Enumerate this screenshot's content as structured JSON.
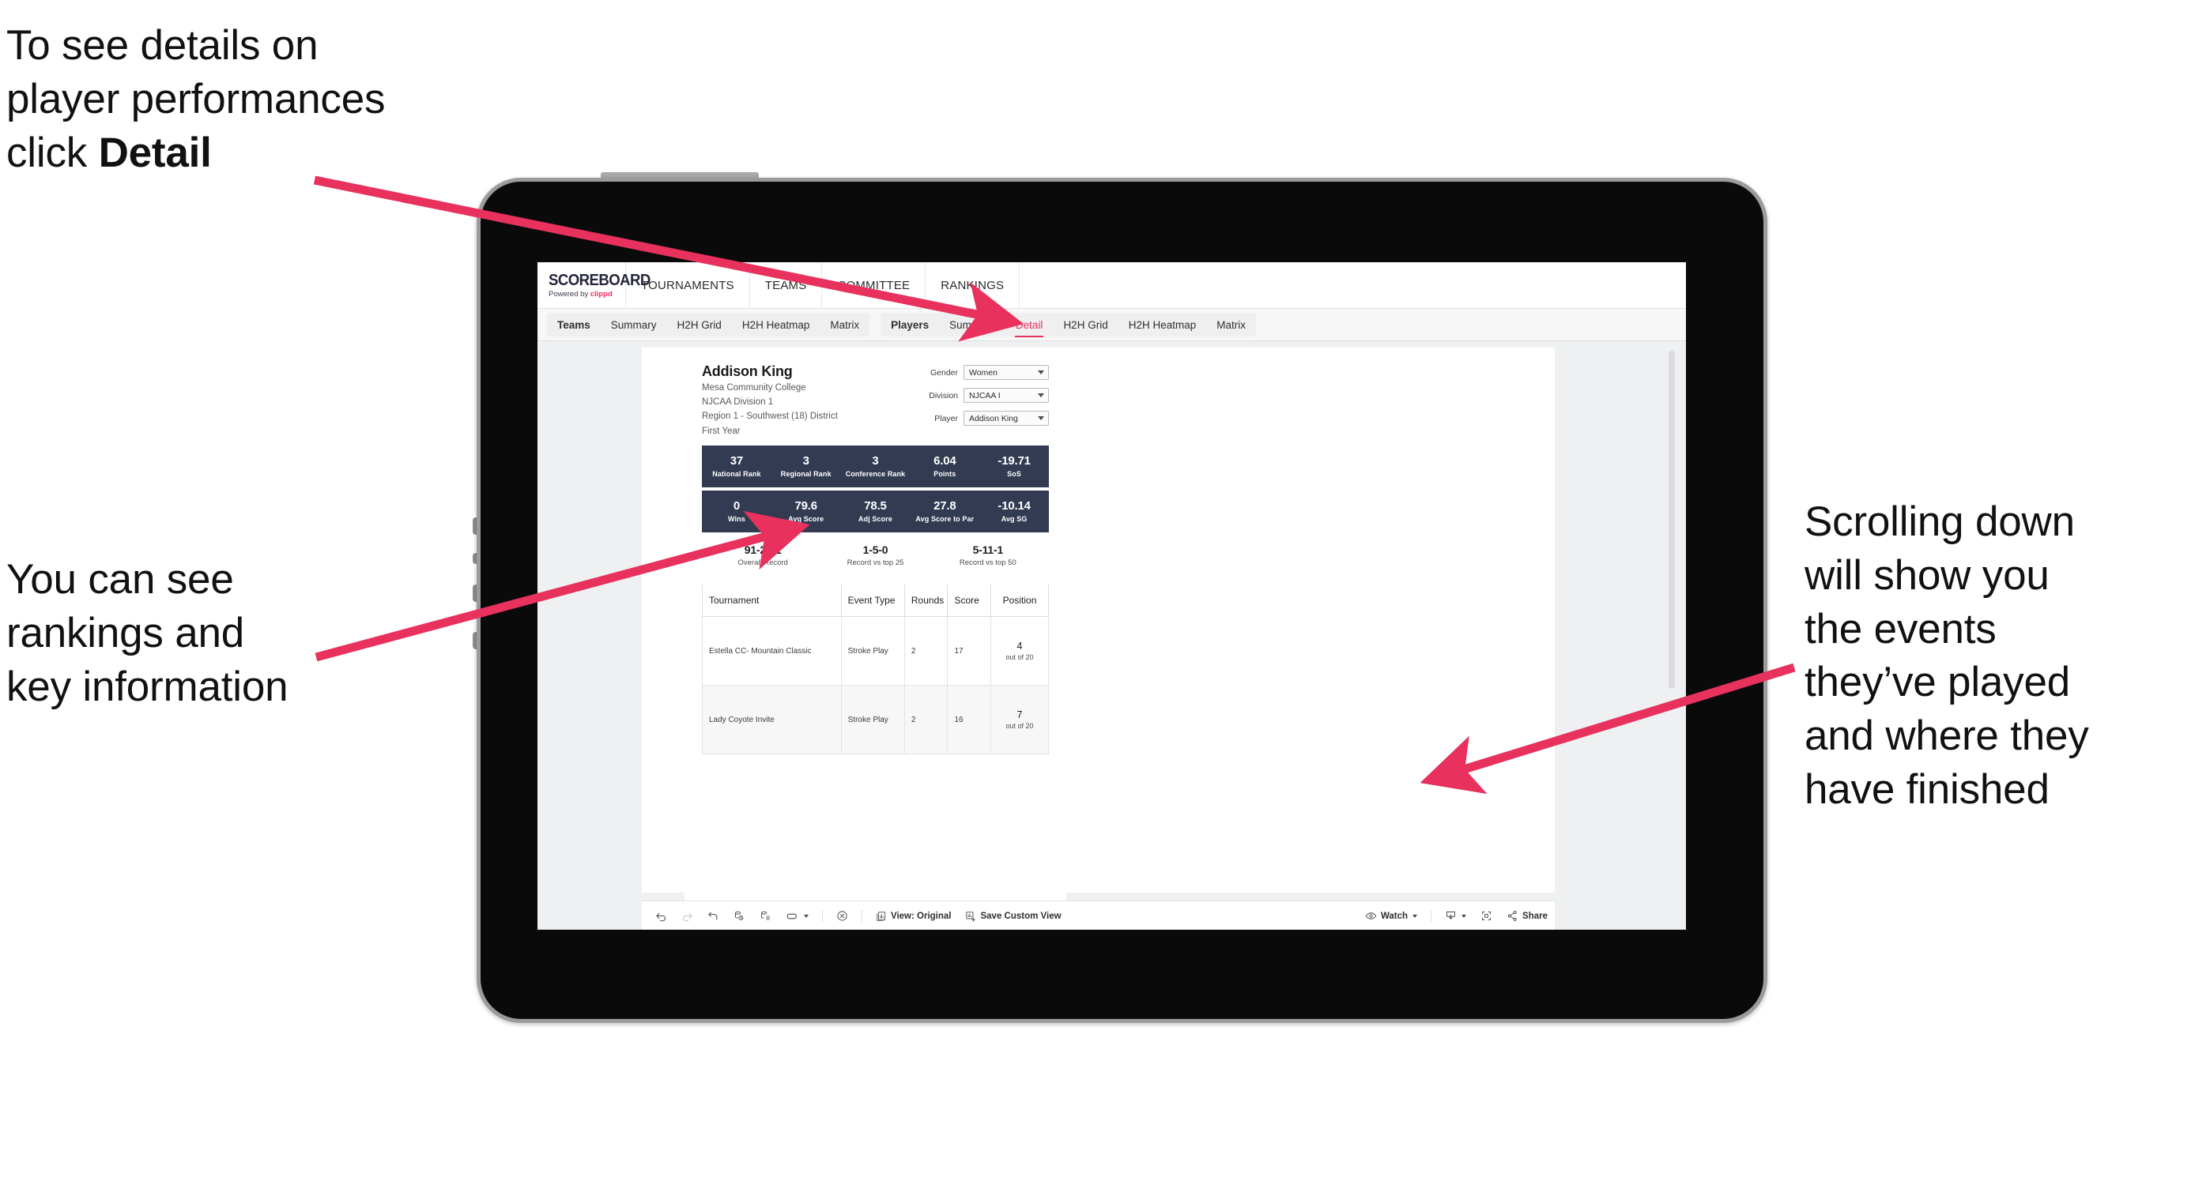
{
  "annotations": {
    "top_left": "To see details on\nplayer performances\nclick ",
    "top_left_bold": "Detail",
    "left": "You can see\nrankings and\nkey information",
    "right": "Scrolling down\nwill show you\nthe events\nthey’ve played\nand where they\nhave finished"
  },
  "colors": {
    "accent_pink": "#ec2d62",
    "arrow_pink": "#e8315d",
    "stat_bar_navy": "#323b52",
    "active_tab": "#e8315d"
  },
  "app": {
    "logo": {
      "main": "SCOREBOARD",
      "powered_prefix": "Powered by ",
      "brand": "clippd"
    },
    "top_nav": [
      "TOURNAMENTS",
      "TEAMS",
      "COMMITTEE",
      "RANKINGS"
    ],
    "sub_nav": {
      "teams_group": [
        "Teams",
        "Summary",
        "H2H Grid",
        "H2H Heatmap",
        "Matrix"
      ],
      "players_group": [
        "Players",
        "Summary",
        "Detail",
        "H2H Grid",
        "H2H Heatmap",
        "Matrix"
      ],
      "active": "Detail"
    }
  },
  "player": {
    "name": "Addison King",
    "school": "Mesa Community College",
    "division": "NJCAA Division 1",
    "region": "Region 1 - Southwest (18) District",
    "year": "First Year"
  },
  "filters": [
    {
      "label": "Gender",
      "value": "Women"
    },
    {
      "label": "Division",
      "value": "NJCAA I"
    },
    {
      "label": "Player",
      "value": "Addison King"
    }
  ],
  "stats_row_1": [
    {
      "value": "37",
      "label": "National Rank"
    },
    {
      "value": "3",
      "label": "Regional Rank"
    },
    {
      "value": "3",
      "label": "Conference Rank"
    },
    {
      "value": "6.04",
      "label": "Points"
    },
    {
      "value": "-19.71",
      "label": "SoS"
    }
  ],
  "stats_row_2": [
    {
      "value": "0",
      "label": "Wins"
    },
    {
      "value": "79.6",
      "label": "Avg Score"
    },
    {
      "value": "78.5",
      "label": "Adj Score"
    },
    {
      "value": "27.8",
      "label": "Avg Score to Par"
    },
    {
      "value": "-10.14",
      "label": "Avg SG"
    }
  ],
  "records": [
    {
      "value": "91-20-1",
      "label": "Overall Record"
    },
    {
      "value": "1-5-0",
      "label": "Record vs top 25"
    },
    {
      "value": "5-11-1",
      "label": "Record vs top 50"
    }
  ],
  "events_table": {
    "columns": [
      "Tournament",
      "Event Type",
      "Rounds",
      "Score",
      "Position"
    ],
    "rows": [
      {
        "tournament": "Estella CC- Mountain Classic",
        "event_type": "Stroke Play",
        "rounds": "2",
        "score": "17",
        "position": "4",
        "position_of": "out of 20"
      },
      {
        "tournament": "Lady Coyote Invite",
        "event_type": "Stroke Play",
        "rounds": "2",
        "score": "16",
        "position": "7",
        "position_of": "out of 20"
      }
    ]
  },
  "toolbar": {
    "view_label": "View: Original",
    "save_label": "Save Custom View",
    "watch_label": "Watch",
    "share_label": "Share"
  }
}
